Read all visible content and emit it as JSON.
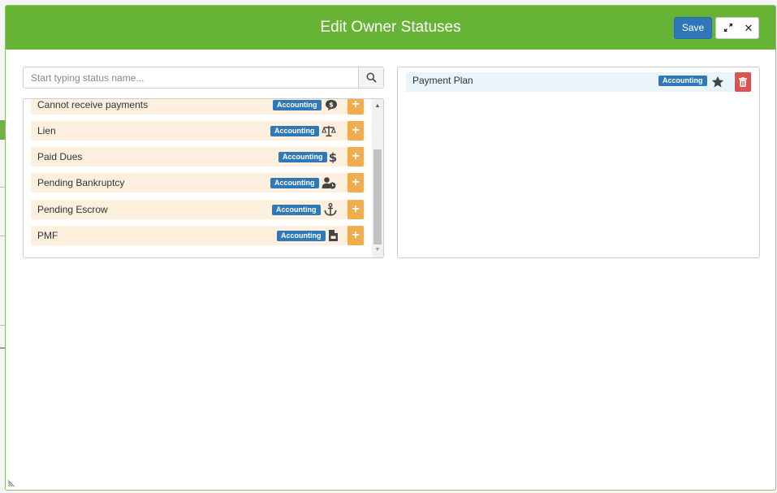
{
  "modal": {
    "title": "Edit Owner Statuses",
    "save_label": "Save",
    "expand_icon": "expand-icon",
    "close_label": "✕"
  },
  "search": {
    "placeholder": "Start typing status name...",
    "value": "",
    "icon": "search-icon"
  },
  "available_statuses": [
    {
      "name": "Cannot receive payments",
      "category": "Accounting",
      "icon": "money-bubble-icon"
    },
    {
      "name": "Lien",
      "category": "Accounting",
      "icon": "balance-scale-icon"
    },
    {
      "name": "Paid Dues",
      "category": "Accounting",
      "icon": "dollar-icon"
    },
    {
      "name": "Pending Bankruptcy",
      "category": "Accounting",
      "icon": "user-clock-icon"
    },
    {
      "name": "Pending Escrow",
      "category": "Accounting",
      "icon": "anchor-icon"
    },
    {
      "name": "PMF",
      "category": "Accounting",
      "icon": "file-invoice-icon"
    }
  ],
  "add_label": "+",
  "selected_statuses": [
    {
      "name": "Payment Plan",
      "category": "Accounting",
      "icon": "star-icon"
    }
  ],
  "colors": {
    "header": "#67b336",
    "save": "#2f77b8",
    "badge": "#2f78b9",
    "add": "#f0ad4e",
    "delete": "#d9534f",
    "row_available": "#fdf0df",
    "row_selected": "#eaf4fb"
  }
}
